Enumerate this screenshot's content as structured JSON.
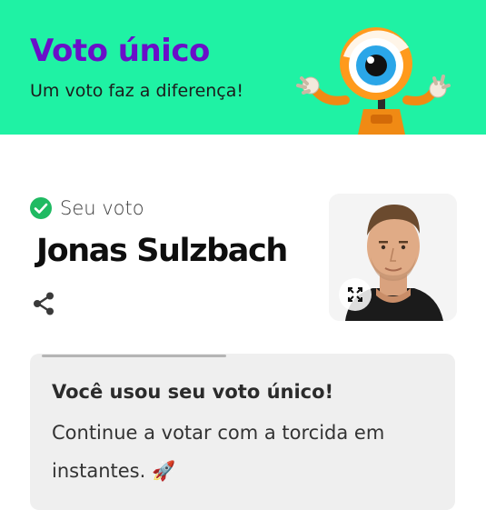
{
  "header": {
    "title": "Voto único",
    "subtitle": "Um voto faz a diferença!",
    "mascot_icon": "big-eye-mascot",
    "background_color": "#1ff2a4",
    "title_color": "#6a0fc8"
  },
  "vote": {
    "status_label": "Seu voto",
    "status_icon": "check-circle-icon",
    "status_color": "#1fba62",
    "candidate_name": "Jonas Sulzbach",
    "share_icon": "share-icon",
    "expand_icon": "expand-icon",
    "photo_alt": "Jonas Sulzbach"
  },
  "notice": {
    "title": "Você usou seu voto único!",
    "body_text": "Continue a votar com a torcida em instantes.",
    "emoji": "🚀"
  }
}
